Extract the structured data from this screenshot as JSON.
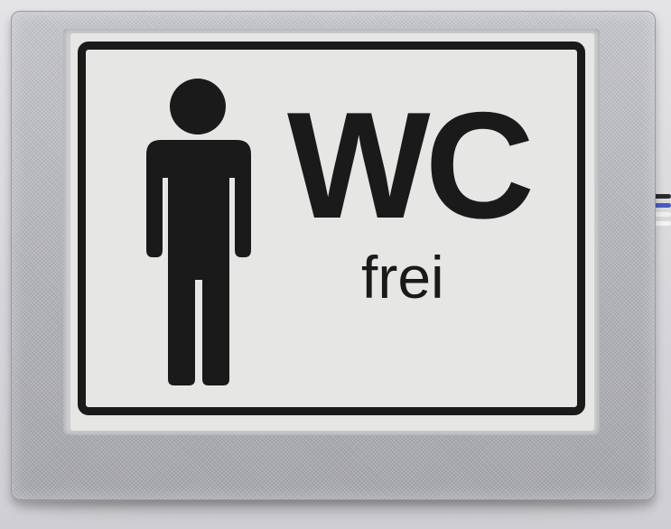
{
  "sign": {
    "title": "WC",
    "status": "frei",
    "icon": "male-person-icon",
    "colors": {
      "ink": "#1a1a1a",
      "screen": "#e6e6e4",
      "frame": "#b7b8bd"
    }
  }
}
